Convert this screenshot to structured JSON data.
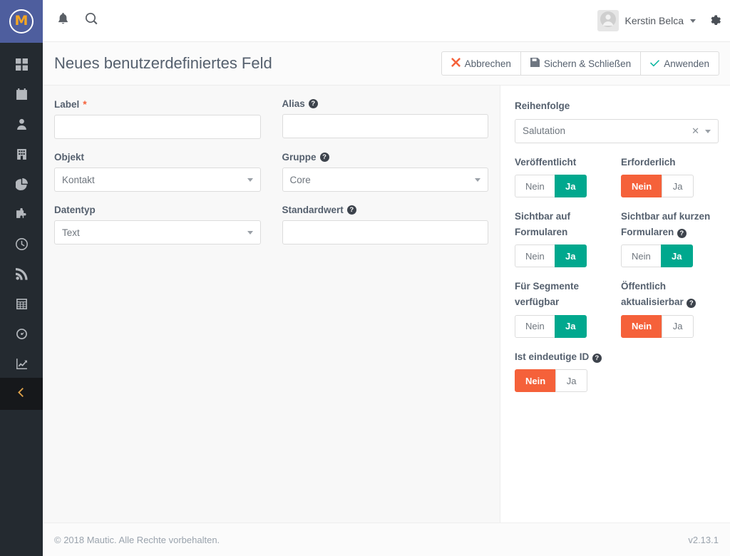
{
  "brand": {
    "logo_letter": "M",
    "logo_name": "mautic-logo"
  },
  "sidebar": {
    "items": [
      {
        "icon": "dashboard-grid-icon",
        "name": "sidebar-item-dashboard"
      },
      {
        "icon": "calendar-icon",
        "name": "sidebar-item-calendar"
      },
      {
        "icon": "contacts-person-icon",
        "name": "sidebar-item-contacts"
      },
      {
        "icon": "company-building-icon",
        "name": "sidebar-item-companies"
      },
      {
        "icon": "segments-pie-icon",
        "name": "sidebar-item-segments"
      },
      {
        "icon": "campaigns-puzzle-icon",
        "name": "sidebar-item-campaigns"
      },
      {
        "icon": "points-clock-icon",
        "name": "sidebar-item-points"
      },
      {
        "icon": "rss-feed-icon",
        "name": "sidebar-item-channels"
      },
      {
        "icon": "table-grid-icon",
        "name": "sidebar-item-components"
      },
      {
        "icon": "speedometer-icon",
        "name": "sidebar-item-stages"
      },
      {
        "icon": "line-chart-icon",
        "name": "sidebar-item-reports"
      }
    ],
    "collapse": {
      "icon": "chevron-left-icon",
      "name": "sidebar-collapse-button"
    }
  },
  "header": {
    "notifications_icon": "bell-icon",
    "search_icon": "search-icon",
    "user_name": "Kerstin Belca",
    "avatar_icon": "user-avatar-icon",
    "caret_icon": "chevron-down-icon",
    "settings_icon": "gear-icon"
  },
  "page": {
    "title": "Neues benutzerdefiniertes Feld"
  },
  "toolbar": {
    "cancel_label": "Abbrechen",
    "save_close_label": "Sichern & Schließen",
    "apply_label": "Anwenden",
    "cancel_icon": "times-icon",
    "save_icon": "floppy-save-icon",
    "apply_icon": "check-icon"
  },
  "form": {
    "label": {
      "label": "Label",
      "required_mark": "*",
      "value": "",
      "placeholder": ""
    },
    "alias": {
      "label": "Alias",
      "help": "?",
      "value": "",
      "placeholder": ""
    },
    "object": {
      "label": "Objekt",
      "value": "Kontakt"
    },
    "group": {
      "label": "Gruppe",
      "help": "?",
      "value": "Core"
    },
    "datatype": {
      "label": "Datentyp",
      "value": "Text"
    },
    "defaultvalue": {
      "label": "Standardwert",
      "help": "?",
      "value": "",
      "placeholder": ""
    }
  },
  "sidepanel": {
    "order": {
      "label": "Reihenfolge",
      "value": "Salutation",
      "clear_icon": "times-clear-icon",
      "caret_icon": "caret-down-icon"
    },
    "toggles": [
      {
        "name": "published",
        "label": "Veröffentlicht",
        "help": null,
        "no": "Nein",
        "yes": "Ja",
        "selected": "yes"
      },
      {
        "name": "required",
        "label": "Erforderlich",
        "help": null,
        "no": "Nein",
        "yes": "Ja",
        "selected": "no"
      },
      {
        "name": "visible-on-forms",
        "label": "Sichtbar auf Formularen",
        "help": null,
        "no": "Nein",
        "yes": "Ja",
        "selected": "yes"
      },
      {
        "name": "visible-on-short-forms",
        "label": "Sichtbar auf kurzen Formularen",
        "help": "?",
        "no": "Nein",
        "yes": "Ja",
        "selected": "yes"
      },
      {
        "name": "available-for-segments",
        "label": "Für Segmente verfügbar",
        "help": null,
        "no": "Nein",
        "yes": "Ja",
        "selected": "yes"
      },
      {
        "name": "publicly-updatable",
        "label": "Öffentlich aktualisierbar",
        "help": "?",
        "no": "Nein",
        "yes": "Ja",
        "selected": "no"
      },
      {
        "name": "is-unique-identifier",
        "label": "Ist eindeutige ID",
        "help": "?",
        "no": "Nein",
        "yes": "Ja",
        "selected": "no"
      }
    ]
  },
  "footer": {
    "copyright": "© 2018 Mautic. Alle Rechte vorbehalten.",
    "version": "v2.13.1"
  },
  "colors": {
    "brand_blue": "#4e5e9e",
    "rail_dark": "#242a30",
    "teal": "#00a88e",
    "orange": "#f5613a",
    "text": "#55606e"
  }
}
